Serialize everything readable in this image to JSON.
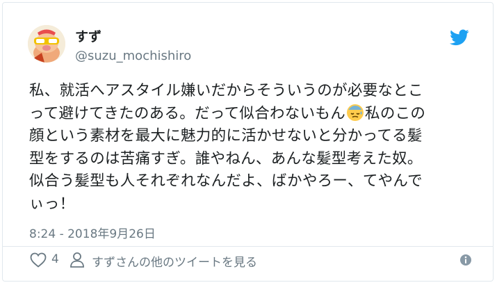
{
  "user": {
    "name": "すず",
    "handle": "@suzu_mochishiro"
  },
  "tweet": {
    "lines": [
      "私、就活へアスタイル嫌いだからそういうのが必要なとこ",
      "って避けてきたのある。だって似合わないもん",
      "私のこの",
      "顔という素材を最大に魅力的に活かせないと分かってる髪",
      "型をするのは苦痛すぎ。誰やねん、あんな髪型考えた奴。",
      "似合う髪型も人それぞれなんだよ、ばかやろー、てやんで",
      "ぃっ！"
    ],
    "emoji_name": "sweat-face-icon",
    "timestamp": "8:24 - 2018年9月26日"
  },
  "footer": {
    "like_count": "4",
    "more_tweets_label": "すずさんの他のツイートを見る"
  },
  "colors": {
    "twitter_blue": "#1da1f2",
    "text": "#1c2022",
    "muted": "#697882"
  }
}
